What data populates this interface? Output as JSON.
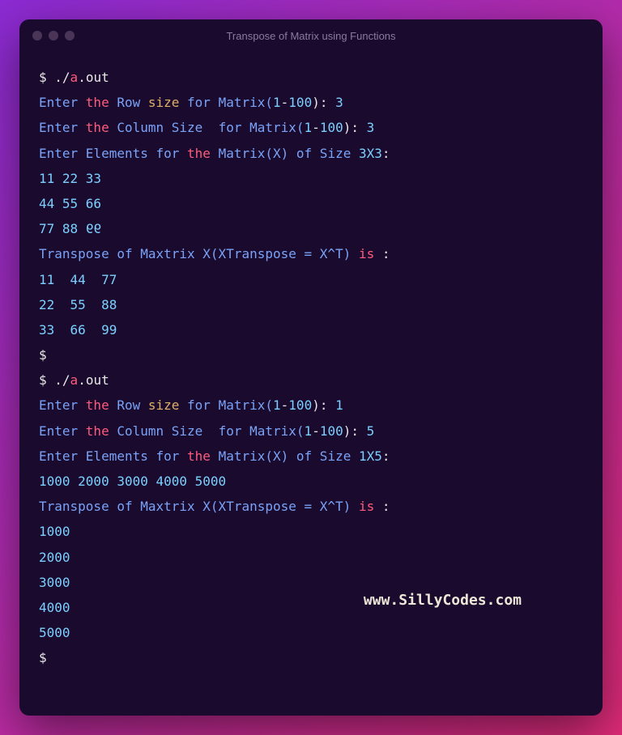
{
  "window": {
    "title": "Transpose of Matrix using Functions"
  },
  "terminal": {
    "run1": {
      "prompt": "$",
      "cmd_prefix": "./",
      "cmd_a": "a",
      "cmd_out": ".out",
      "row_prompt_enter": "Enter ",
      "the": "the",
      "row_text": " Row ",
      "size_text": "size",
      "for_text": " for ",
      "matrix_open": "Matrix(",
      "one": "1",
      "dash": "-",
      "hundred": "100",
      "close_colon": "): ",
      "row_val": "3",
      "col_text": " Column Size ",
      "col_val": "3",
      "elements_text": "Enter Elements ",
      "for2": "for ",
      "matrix_x": " Matrix(X) ",
      "of_size": "of Size ",
      "size_3x3": "3X3",
      "colon": ":",
      "m_row1": "11 22 33",
      "m_row2": "44 55 66",
      "m_row3_a": "77 88 ",
      "m_row3_b": "99",
      "transpose_text": "Transpose ",
      "of_text": "of Maxtrix X(XTranspose = X^T) ",
      "is_text": "is",
      "space_colon": " :",
      "t_row1": "11  44  77",
      "t_row2": "22  55  88",
      "t_row3": "33  66  99"
    },
    "run2": {
      "row_val": "1",
      "col_val": "5",
      "size_1x5": "1X5",
      "m_row1": "1000 2000 3000 4000 5000",
      "t_row1": "1000",
      "t_row2": "2000",
      "t_row3": "3000",
      "t_row4": "4000",
      "t_row5": "5000"
    }
  },
  "watermark": "www.SillyCodes.com"
}
